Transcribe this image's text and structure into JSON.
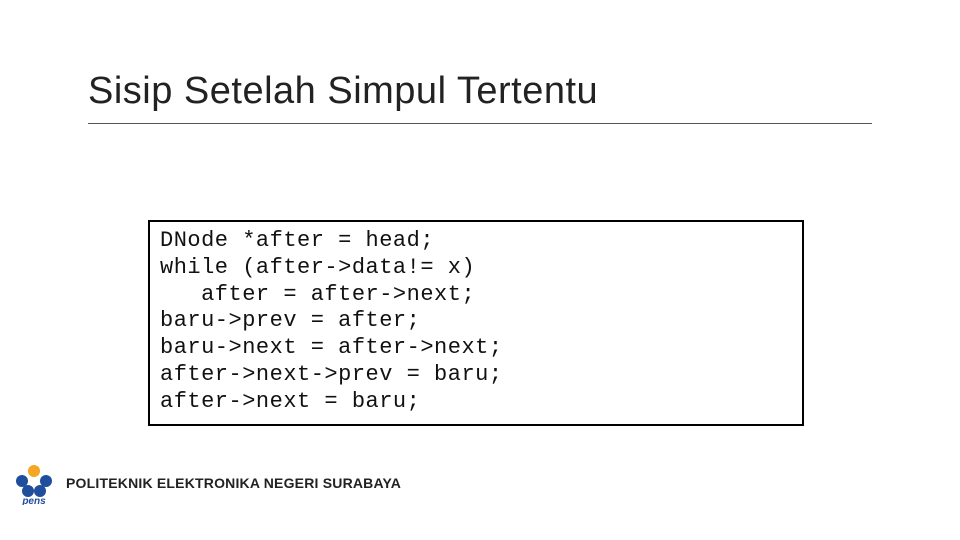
{
  "title": "Sisip Setelah Simpul Tertentu",
  "code_lines": [
    "DNode *after = head;",
    "while (after->data!= x)",
    "   after = after->next;",
    "baru->prev = after;",
    "baru->next = after->next;",
    "after->next->prev = baru;",
    "after->next = baru;"
  ],
  "footer_text": "POLITEKNIK ELEKTRONIKA NEGERI SURABAYA",
  "logo_label": "pens"
}
